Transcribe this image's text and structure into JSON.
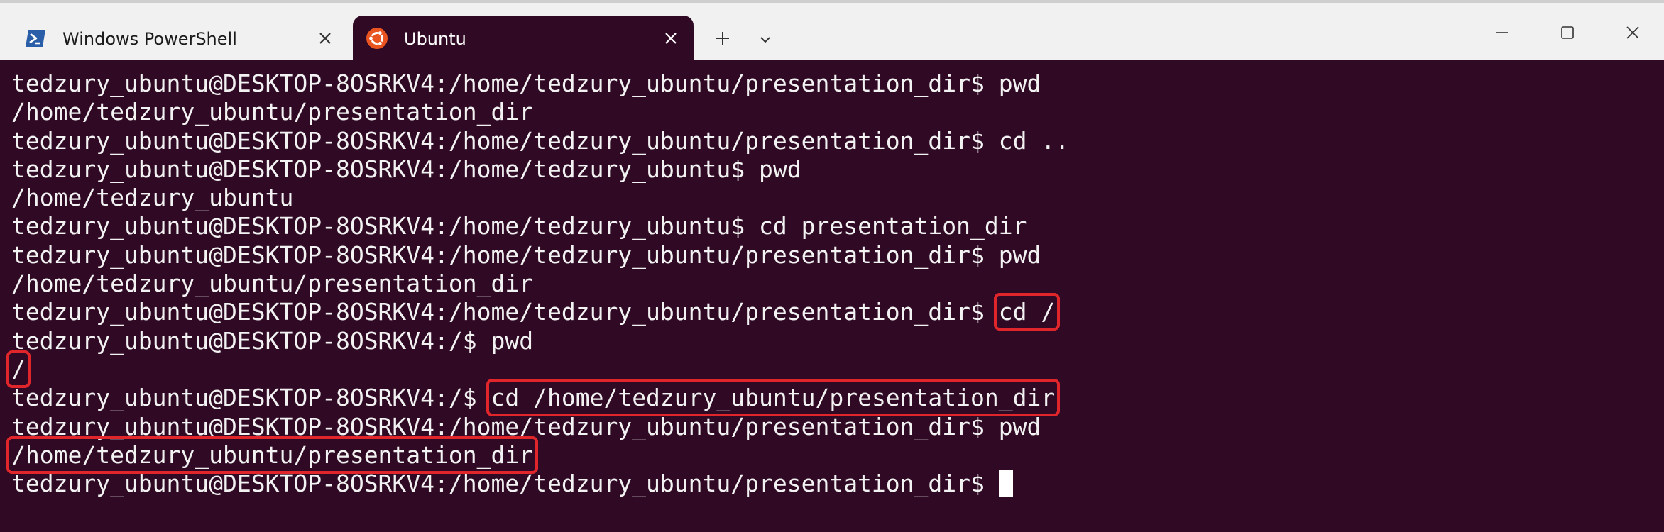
{
  "tabs": [
    {
      "label": "Windows PowerShell",
      "icon": "powershell-icon",
      "active": false
    },
    {
      "label": "Ubuntu",
      "icon": "ubuntu-icon",
      "active": true
    }
  ],
  "colors": {
    "terminal_bg": "#300a24",
    "highlight_box": "#e0262b",
    "text": "#f2f2f2",
    "ubuntu_orange": "#e95420",
    "powershell_blue": "#2b5ea8"
  },
  "terminal": {
    "prompt_home_pres": "tedzury_ubuntu@DESKTOP-8OSRKV4:/home/tedzury_ubuntu/presentation_dir$ ",
    "prompt_home": "tedzury_ubuntu@DESKTOP-8OSRKV4:/home/tedzury_ubuntu$ ",
    "prompt_root": "tedzury_ubuntu@DESKTOP-8OSRKV4:/$ ",
    "lines": [
      {
        "prompt": "tedzury_ubuntu@DESKTOP-8OSRKV4:/home/tedzury_ubuntu/presentation_dir$ ",
        "cmd": "pwd"
      },
      {
        "output": "/home/tedzury_ubuntu/presentation_dir"
      },
      {
        "prompt": "tedzury_ubuntu@DESKTOP-8OSRKV4:/home/tedzury_ubuntu/presentation_dir$ ",
        "cmd": "cd .."
      },
      {
        "prompt": "tedzury_ubuntu@DESKTOP-8OSRKV4:/home/tedzury_ubuntu$ ",
        "cmd": "pwd"
      },
      {
        "output": "/home/tedzury_ubuntu"
      },
      {
        "prompt": "tedzury_ubuntu@DESKTOP-8OSRKV4:/home/tedzury_ubuntu$ ",
        "cmd": "cd presentation_dir"
      },
      {
        "prompt": "tedzury_ubuntu@DESKTOP-8OSRKV4:/home/tedzury_ubuntu/presentation_dir$ ",
        "cmd": "pwd"
      },
      {
        "output": "/home/tedzury_ubuntu/presentation_dir"
      },
      {
        "prompt": "tedzury_ubuntu@DESKTOP-8OSRKV4:/home/tedzury_ubuntu/presentation_dir$ ",
        "cmd": "cd /"
      },
      {
        "prompt": "tedzury_ubuntu@DESKTOP-8OSRKV4:/$ ",
        "cmd": "pwd"
      },
      {
        "output": "/"
      },
      {
        "prompt": "tedzury_ubuntu@DESKTOP-8OSRKV4:/$ ",
        "cmd": "cd /home/tedzury_ubuntu/presentation_dir"
      },
      {
        "prompt": "tedzury_ubuntu@DESKTOP-8OSRKV4:/home/tedzury_ubuntu/presentation_dir$ ",
        "cmd": "pwd"
      },
      {
        "output": "/home/tedzury_ubuntu/presentation_dir"
      },
      {
        "prompt": "tedzury_ubuntu@DESKTOP-8OSRKV4:/home/tedzury_ubuntu/presentation_dir$ ",
        "cmd": ""
      }
    ]
  }
}
